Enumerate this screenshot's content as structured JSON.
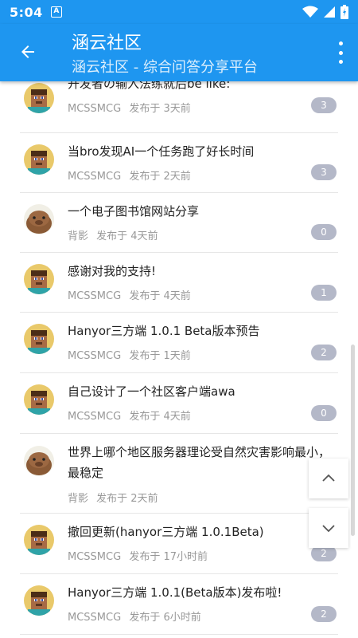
{
  "status": {
    "time": "5:04",
    "notif_letter": "A"
  },
  "appbar": {
    "title": "涵云社区",
    "subtitle": "涵云社区 - 综合问答分享平台"
  },
  "colors": {
    "primary": "#1e96f0",
    "badge": "#b4b8c8"
  },
  "posts": [
    {
      "title": "开发者の输入法练就后be like:",
      "author": "MCSSMCG",
      "time": "发布于 3天前",
      "count": "3",
      "avatar": "minecraft-steve"
    },
    {
      "title": "当bro发现AI一个任务跑了好长时间",
      "author": "MCSSMCG",
      "time": "发布于 2天前",
      "count": "3",
      "avatar": "minecraft-steve"
    },
    {
      "title": "一个电子图书馆网站分享",
      "author": "背影",
      "time": "发布于 4天前",
      "count": "0",
      "avatar": "capybara"
    },
    {
      "title": "感谢对我的支持!",
      "author": "MCSSMCG",
      "time": "发布于 4天前",
      "count": "1",
      "avatar": "minecraft-steve"
    },
    {
      "title": "Hanyor三方端 1.0.1 Beta版本预告",
      "author": "MCSSMCG",
      "time": "发布于 1天前",
      "count": "2",
      "avatar": "minecraft-steve"
    },
    {
      "title": "自己设计了一个社区客户端awa",
      "author": "MCSSMCG",
      "time": "发布于 4天前",
      "count": "0",
      "avatar": "minecraft-steve"
    },
    {
      "title": "世界上哪个地区服务器理论受自然灾害影响最小，最稳定",
      "author": "背影",
      "time": "发布于 2天前",
      "count": "",
      "avatar": "capybara"
    },
    {
      "title": "撤回更新(hanyor三方端 1.0.1Beta)",
      "author": "MCSSMCG",
      "time": "发布于 17小时前",
      "count": "2",
      "avatar": "minecraft-steve"
    },
    {
      "title": "Hanyor三方端 1.0.1(Beta版本)发布啦!",
      "author": "MCSSMCG",
      "time": "发布于 6小时前",
      "count": "2",
      "avatar": "minecraft-steve"
    }
  ],
  "icons": {
    "back": "arrow-back-icon",
    "menu": "more-vert-icon",
    "scroll_up": "chevron-up-icon",
    "scroll_down": "chevron-down-icon"
  }
}
